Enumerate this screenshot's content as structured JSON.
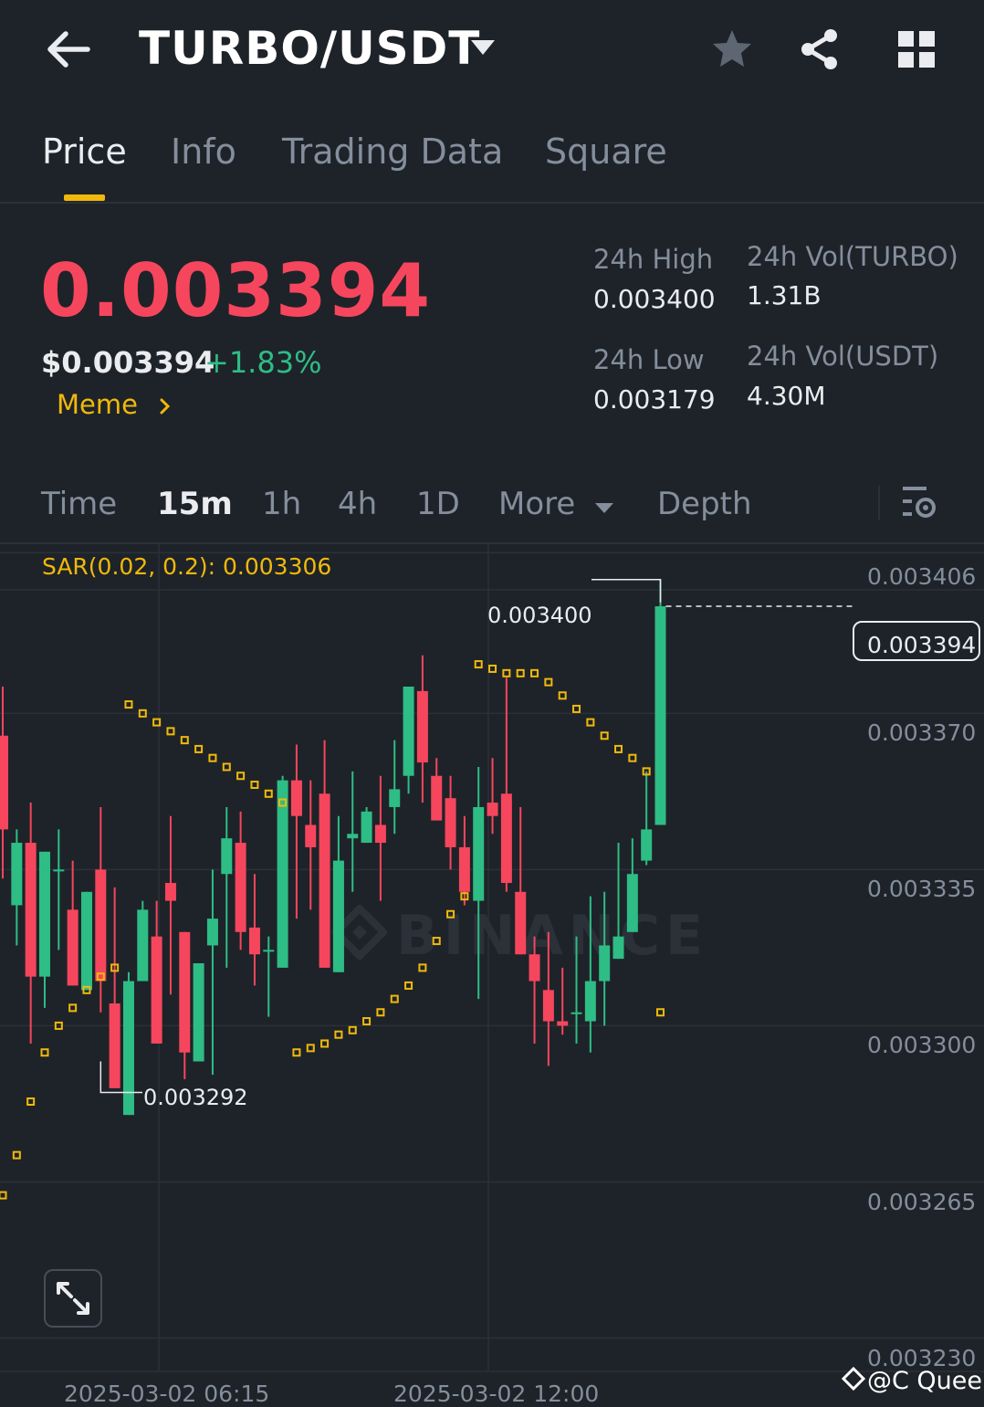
{
  "header": {
    "pair": "TURBO/USDT",
    "icons": [
      "back-arrow-icon",
      "caret-down-icon",
      "star-icon",
      "share-icon",
      "grid-icon"
    ]
  },
  "tabs": [
    {
      "label": "Price",
      "active": true
    },
    {
      "label": "Info",
      "active": false
    },
    {
      "label": "Trading Data",
      "active": false
    },
    {
      "label": "Square",
      "active": false
    }
  ],
  "ticker": {
    "last_price": "0.003394",
    "usd_price": "$0.003394",
    "change_pct": "+1.83%",
    "tag": "Meme",
    "high_label": "24h High",
    "high_value": "0.003400",
    "low_label": "24h Low",
    "low_value": "0.003179",
    "vol_base_label": "24h Vol(TURBO)",
    "vol_base_value": "1.31B",
    "vol_quote_label": "24h Vol(USDT)",
    "vol_quote_value": "4.30M"
  },
  "intervals": [
    {
      "label": "Time",
      "active": false
    },
    {
      "label": "15m",
      "active": true
    },
    {
      "label": "1h",
      "active": false
    },
    {
      "label": "4h",
      "active": false
    },
    {
      "label": "1D",
      "active": false
    },
    {
      "label": "More",
      "active": false
    },
    {
      "label": "Depth",
      "active": false
    }
  ],
  "colors": {
    "up": "#2ebd85",
    "down": "#f6465d",
    "accent": "#f0b90b",
    "background": "#1e2329"
  },
  "chart": {
    "indicator": "SAR(0.02, 0.2): 0.003306",
    "price_axis": [
      "0.003406",
      "0.003370",
      "0.003335",
      "0.003300",
      "0.003265",
      "0.003230"
    ],
    "time_axis": [
      "2025-03-02 06:15",
      "2025-03-02 12:00"
    ],
    "last_price_label": "0.003394",
    "high_marker": "0.003400",
    "low_marker": "0.003292",
    "watermark": "BINANCE",
    "credit": "@C Queen"
  },
  "chart_data": {
    "type": "candlestick",
    "ylim": [
      0.003225,
      0.003414
    ],
    "price_ticks": [
      0.003406,
      0.00337,
      0.003335,
      0.0033,
      0.003265,
      0.00323
    ],
    "candles": [
      {
        "o": 0.003365,
        "h": 0.003376,
        "c": 0.003344,
        "l": 0.003333
      },
      {
        "o": 0.003327,
        "h": 0.003344,
        "c": 0.003341,
        "l": 0.003318
      },
      {
        "o": 0.003341,
        "h": 0.00335,
        "c": 0.003311,
        "l": 0.003296
      },
      {
        "o": 0.003311,
        "h": 0.003339,
        "c": 0.003339,
        "l": 0.003304
      },
      {
        "o": 0.003335,
        "h": 0.003344,
        "c": 0.003335,
        "l": 0.003317
      },
      {
        "o": 0.003326,
        "h": 0.003337,
        "c": 0.003309,
        "l": 0.00331
      },
      {
        "o": 0.003308,
        "h": 0.003322,
        "c": 0.00333,
        "l": 0.003325
      },
      {
        "o": 0.003335,
        "h": 0.003349,
        "c": 0.00331,
        "l": 0.003303
      },
      {
        "o": 0.003305,
        "h": 0.003331,
        "c": 0.003286,
        "l": 0.003286
      },
      {
        "o": 0.00328,
        "h": 0.003312,
        "c": 0.00331,
        "l": 0.00328
      },
      {
        "o": 0.00331,
        "h": 0.003328,
        "c": 0.003326,
        "l": 0.003321
      },
      {
        "o": 0.00332,
        "h": 0.003328,
        "c": 0.003296,
        "l": 0.003299
      },
      {
        "o": 0.003332,
        "h": 0.003347,
        "c": 0.003328,
        "l": 0.003307
      },
      {
        "o": 0.003321,
        "h": 0.003321,
        "c": 0.003294,
        "l": 0.003288
      },
      {
        "o": 0.003292,
        "h": 0.003313,
        "c": 0.003314,
        "l": 0.003307
      },
      {
        "o": 0.003318,
        "h": 0.003335,
        "c": 0.003324,
        "l": 0.003289
      },
      {
        "o": 0.003334,
        "h": 0.003349,
        "c": 0.003342,
        "l": 0.003313
      },
      {
        "o": 0.003341,
        "h": 0.003348,
        "c": 0.003321,
        "l": 0.003317
      },
      {
        "o": 0.003322,
        "h": 0.003334,
        "c": 0.003316,
        "l": 0.003309
      },
      {
        "o": 0.003317,
        "h": 0.00332,
        "c": 0.003317,
        "l": 0.003302
      },
      {
        "o": 0.003313,
        "h": 0.003356,
        "c": 0.003355,
        "l": 0.00333
      },
      {
        "o": 0.003355,
        "h": 0.003363,
        "c": 0.003347,
        "l": 0.003324
      },
      {
        "o": 0.003345,
        "h": 0.003355,
        "c": 0.00334,
        "l": 0.003326
      },
      {
        "o": 0.003352,
        "h": 0.003364,
        "c": 0.003313,
        "l": 0.003313
      },
      {
        "o": 0.003312,
        "h": 0.003347,
        "c": 0.003337,
        "l": 0.003315
      },
      {
        "o": 0.003342,
        "h": 0.003357,
        "c": 0.003343,
        "l": 0.00333
      },
      {
        "o": 0.003341,
        "h": 0.003349,
        "c": 0.003348,
        "l": 0.003348
      },
      {
        "o": 0.003345,
        "h": 0.003356,
        "c": 0.003341,
        "l": 0.003328
      },
      {
        "o": 0.003349,
        "h": 0.003364,
        "c": 0.003353,
        "l": 0.003343
      },
      {
        "o": 0.003356,
        "h": 0.003376,
        "c": 0.003376,
        "l": 0.003352
      },
      {
        "o": 0.003375,
        "h": 0.003383,
        "c": 0.003359,
        "l": 0.00335
      },
      {
        "o": 0.003356,
        "h": 0.00336,
        "c": 0.003346,
        "l": 0.003347
      },
      {
        "o": 0.003351,
        "h": 0.003356,
        "c": 0.00334,
        "l": 0.003335
      },
      {
        "o": 0.00334,
        "h": 0.003347,
        "c": 0.00333,
        "l": 0.003327
      },
      {
        "o": 0.003328,
        "h": 0.003358,
        "c": 0.003349,
        "l": 0.003306
      },
      {
        "o": 0.00335,
        "h": 0.00336,
        "c": 0.003347,
        "l": 0.003343
      },
      {
        "o": 0.003352,
        "h": 0.003378,
        "c": 0.003332,
        "l": 0.00333
      },
      {
        "o": 0.00333,
        "h": 0.003349,
        "c": 0.003316,
        "l": 0.003324
      },
      {
        "o": 0.003316,
        "h": 0.00332,
        "c": 0.00331,
        "l": 0.003296
      },
      {
        "o": 0.003308,
        "h": 0.003321,
        "c": 0.003301,
        "l": 0.003291
      },
      {
        "o": 0.003301,
        "h": 0.003313,
        "c": 0.0033,
        "l": 0.003298
      },
      {
        "o": 0.003303,
        "h": 0.00332,
        "c": 0.003303,
        "l": 0.003296
      },
      {
        "o": 0.003301,
        "h": 0.003329,
        "c": 0.00331,
        "l": 0.003294
      },
      {
        "o": 0.00331,
        "h": 0.00333,
        "c": 0.003318,
        "l": 0.0033
      },
      {
        "o": 0.003315,
        "h": 0.003341,
        "c": 0.00332,
        "l": 0.00332
      },
      {
        "o": 0.003321,
        "h": 0.003342,
        "c": 0.003334,
        "l": 0.003322
      },
      {
        "o": 0.003337,
        "h": 0.003357,
        "c": 0.003344,
        "l": 0.003336
      },
      {
        "o": 0.003345,
        "h": 0.0034,
        "c": 0.003394,
        "l": 0.003345
      }
    ],
    "sar": [
      0.003262,
      0.003271,
      0.003283,
      0.003294,
      0.0033,
      0.003304,
      0.003308,
      0.003311,
      0.003313,
      0.003372,
      0.00337,
      0.003368,
      0.003366,
      0.003364,
      0.003362,
      0.00336,
      0.003358,
      0.003356,
      0.003354,
      0.003352,
      0.00335,
      0.003294,
      0.003295,
      0.003296,
      0.003298,
      0.003299,
      0.003301,
      0.003303,
      0.003306,
      0.003309,
      0.003313,
      0.003319,
      0.003325,
      0.003329,
      0.003381,
      0.00338,
      0.003379,
      0.003379,
      0.003379,
      0.003377,
      0.003374,
      0.003371,
      0.003368,
      0.003365,
      0.003362,
      0.00336,
      0.003357,
      0.003303
    ]
  }
}
